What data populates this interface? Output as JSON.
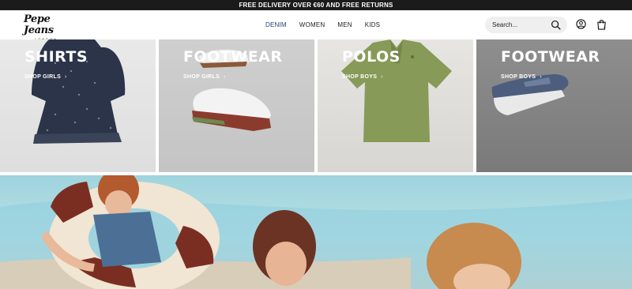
{
  "promo": {
    "text": "FREE DELIVERY OVER €60 AND FREE RETURNS"
  },
  "header": {
    "logo_text": "Pepe Jeans",
    "logo_sub": "LONDON",
    "nav": [
      {
        "label": "DENIM",
        "active": true
      },
      {
        "label": "WOMEN",
        "active": false
      },
      {
        "label": "MEN",
        "active": false
      },
      {
        "label": "KIDS",
        "active": false
      }
    ],
    "search": {
      "placeholder": "Search..."
    },
    "icons": [
      "search-icon",
      "account-icon",
      "bag-icon"
    ],
    "bag_count": "0"
  },
  "tiles": [
    {
      "title": "SHIRTS",
      "link": "SHOP GIRLS"
    },
    {
      "title": "FOOTWEAR",
      "link": "SHOP GIRLS"
    },
    {
      "title": "POLOS",
      "link": "SHOP BOYS"
    },
    {
      "title": "FOOTWEAR",
      "link": "SHOP BOYS"
    }
  ],
  "colors": {
    "promo_bg": "#1b1b1b",
    "nav_active": "#1f3f7a",
    "search_bg": "#efefef"
  }
}
